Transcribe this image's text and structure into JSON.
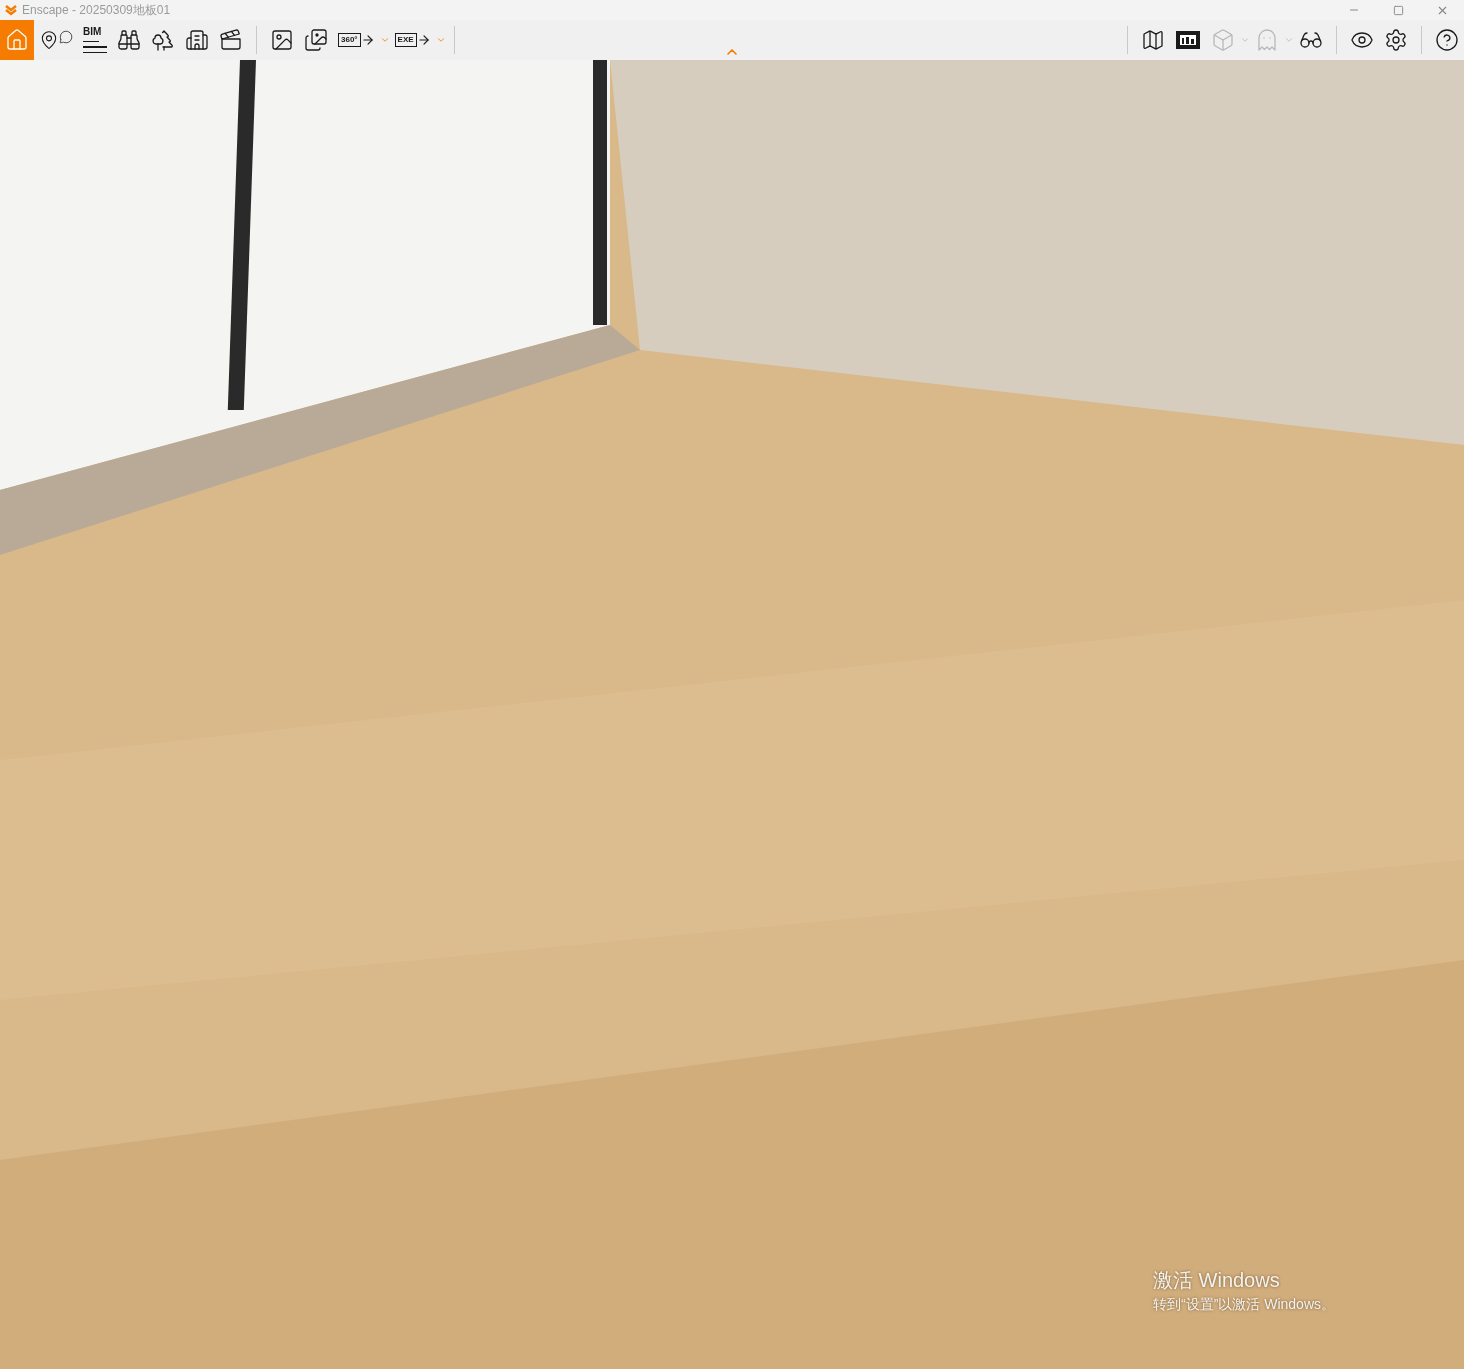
{
  "window": {
    "title": "Enscape - 20250309地板01"
  },
  "toolbar": {
    "left": [
      {
        "selected": true,
        "disabled": false
      },
      {
        "selected": false,
        "disabled": false
      },
      {
        "selected": false,
        "disabled": false,
        "label": "BIM"
      },
      {
        "selected": false,
        "disabled": false
      },
      {
        "selected": false,
        "disabled": false
      },
      {
        "selected": false,
        "disabled": false
      },
      {
        "selected": false,
        "disabled": false
      },
      {
        "selected": false,
        "disabled": false,
        "group_start": true
      },
      {
        "selected": false,
        "disabled": false
      },
      {
        "selected": false,
        "disabled": false,
        "has_menu": true,
        "label": "360°"
      },
      {
        "selected": false,
        "disabled": false,
        "has_menu": true,
        "label": "EXE"
      }
    ],
    "right": [
      {
        "selected": false,
        "disabled": false
      },
      {
        "selected": false,
        "disabled": false
      },
      {
        "selected": false,
        "disabled": true,
        "has_menu": true
      },
      {
        "selected": false,
        "disabled": true,
        "has_menu": true
      },
      {
        "selected": false,
        "disabled": false
      },
      {
        "selected": false,
        "disabled": false,
        "group_start": true
      },
      {
        "selected": false,
        "disabled": false
      },
      {
        "selected": false,
        "disabled": false,
        "group_start": true
      }
    ]
  },
  "activation_notice": {
    "title": "激活 Windows",
    "message": "转到“设置”以激活 Windows。"
  }
}
